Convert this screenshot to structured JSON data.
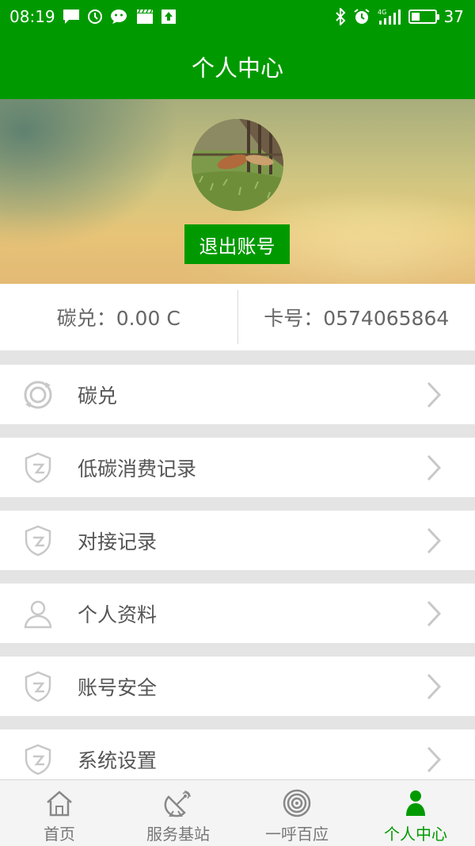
{
  "status_bar": {
    "time": "08:19",
    "battery_level": "37",
    "network_label": "4G",
    "left_icons": [
      "message-icon",
      "clock-icon",
      "wechat-icon",
      "clapper-icon",
      "upload-icon"
    ],
    "right_icons": [
      "bluetooth-icon",
      "alarm-icon",
      "signal-icon",
      "battery-icon"
    ]
  },
  "header": {
    "title": "个人中心"
  },
  "profile": {
    "logout_label": "退出账号"
  },
  "info": {
    "carbon": "碳兑：0.00 C",
    "card": "卡号：0574065864"
  },
  "menu": [
    {
      "label": "碳兑",
      "icon": "refresh-circle-icon"
    },
    {
      "label": "低碳消费记录",
      "icon": "shield-icon"
    },
    {
      "label": "对接记录",
      "icon": "shield-icon"
    },
    {
      "label": "个人资料",
      "icon": "person-icon"
    },
    {
      "label": "账号安全",
      "icon": "shield-icon"
    },
    {
      "label": "系统设置",
      "icon": "shield-icon"
    }
  ],
  "tabs": [
    {
      "label": "首页",
      "icon": "home-icon",
      "active": false
    },
    {
      "label": "服务基站",
      "icon": "satellite-dish-icon",
      "active": false
    },
    {
      "label": "一呼百应",
      "icon": "broadcast-icon",
      "active": false
    },
    {
      "label": "个人中心",
      "icon": "person-icon",
      "active": true
    }
  ],
  "colors": {
    "brand_green": "#009a00",
    "text_gray": "#555555",
    "icon_gray": "#c8c8c8"
  }
}
